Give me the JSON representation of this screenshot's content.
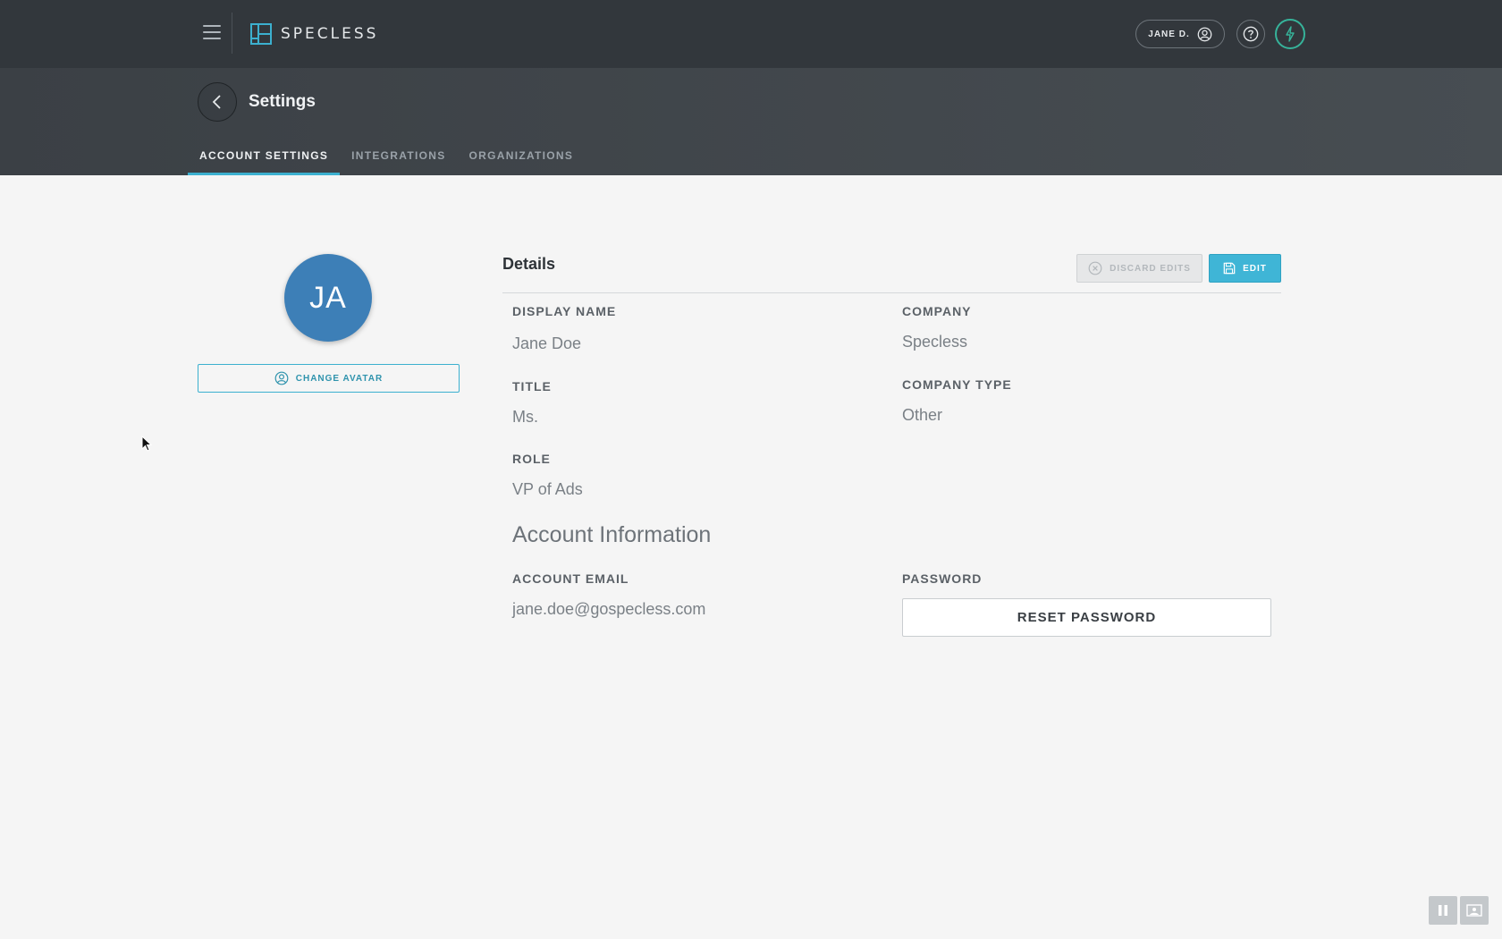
{
  "app": {
    "logo_text": "SPECLESS",
    "user_label": "JANE D."
  },
  "header": {
    "title": "Settings",
    "tabs": [
      {
        "label": "ACCOUNT SETTINGS",
        "active": true
      },
      {
        "label": "INTEGRATIONS",
        "active": false
      },
      {
        "label": "ORGANIZATIONS",
        "active": false
      }
    ]
  },
  "profile": {
    "avatar_initials": "JA",
    "avatar_color": "#3d7fb7",
    "change_avatar_label": "CHANGE AVATAR"
  },
  "details": {
    "title": "Details",
    "discard_label": "DISCARD EDITS",
    "edit_label": "EDIT",
    "display_name_label": "DISPLAY NAME",
    "display_name_value": "Jane Doe",
    "company_label": "COMPANY",
    "company_value": "Specless",
    "title_label": "TITLE",
    "title_value": "Ms.",
    "company_type_label": "COMPANY TYPE",
    "company_type_value": "Other",
    "role_label": "ROLE",
    "role_value": "VP of Ads"
  },
  "account": {
    "section_title": "Account Information",
    "email_label": "ACCOUNT EMAIL",
    "email_value": "jane.doe@gospecless.com",
    "password_label": "PASSWORD",
    "reset_label": "RESET PASSWORD"
  },
  "colors": {
    "topbar": "#32373c",
    "accent": "#3fb5d6",
    "bolt": "#36b39a"
  },
  "icons": {
    "menu": "hamburger-menu-icon",
    "logo": "specless-logo-icon",
    "user": "user-circle-icon",
    "help": "question-circle-icon",
    "bolt": "lightning-bolt-icon",
    "back": "chevron-left-icon",
    "discard": "x-circle-icon",
    "save": "floppy-disk-icon"
  }
}
